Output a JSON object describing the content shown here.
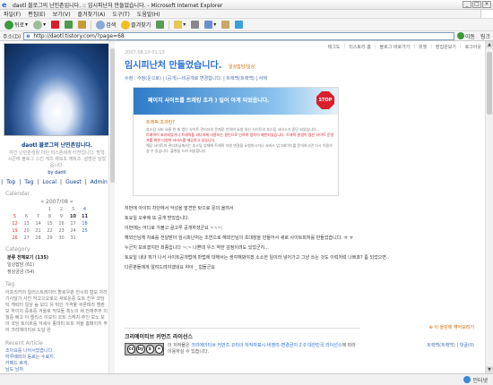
{
  "window": {
    "title": "daotl 블로그의 난민촌입니다. :: 임시피난처 만들었습니다. - Microsoft Internet Explorer"
  },
  "menu": [
    "파일(F)",
    "편집(E)",
    "보기(V)",
    "즐겨찾기(A)",
    "도구(T)",
    "도움말(H)"
  ],
  "toolbar": {
    "back": "뒤로",
    "search": "검색",
    "favorites": "즐겨찾기"
  },
  "address": {
    "label": "주소(D)",
    "url": "http://daotl.tistory.com/?page=68",
    "go": "이동",
    "links": "링크"
  },
  "sidebar": {
    "blog_title": "daotl 블로그의 난민촌입니다.",
    "blog_desc": "여긴 난민촌생활 이던 미스폰에게 터전입니다. 방학 시즌에 블로그 스킨 계조 재복초 재복조. 설명은 달았읍니다.",
    "blog_owner": "by daotl",
    "nav": [
      "Top",
      "Tag",
      "Local",
      "Guest",
      "Admin"
    ],
    "calendar_label": "Calendar",
    "calendar_month": "« 2007/08 »",
    "calendar_rows": [
      [
        "",
        "",
        "",
        "1",
        "2",
        "3",
        "4"
      ],
      [
        "5",
        "6",
        "7",
        "8",
        "9",
        "10",
        "11"
      ],
      [
        "12",
        "13",
        "14",
        "15",
        "16",
        "17",
        "18"
      ],
      [
        "19",
        "20",
        "21",
        "22",
        "23",
        "24",
        "25"
      ],
      [
        "26",
        "27",
        "28",
        "29",
        "30",
        "31",
        ""
      ]
    ],
    "category_label": "Category",
    "categories": [
      "분류 전체보기 (135)",
      "일상잡담 (61)",
      "정상궁금 (54)"
    ],
    "tag_label": "Tag",
    "tags": "아프리카의 일러스트레이터 할로우퀸 전시회 협보 차리기사달기 사진 하고으오로오 새로운중 도트 친우 코딩턱 캐릭터 일상 숲 모디 유 턱인 가격물 쿠폰테라 캠판보 하이치 중복중 겨울로 악보들 흑노의 세 전재주부 이월중 배고 이 엘리스 이모티 코트 스케치 주인 모노 모이 코딩 토이르를 악세사 종마미 트트 겨울 홈페이지 주어 크리에이티브 도달 원",
    "recent_label": "Recent Article",
    "recent": [
      "조아요를 나아서었습니다.",
      "하루배려의 동료는 수료지.",
      "카페드 휴게.",
      "님도 님자."
    ]
  },
  "main": {
    "topnav": [
      "태그도",
      "티스토리 홈",
      "블로그 바로가기",
      "위젯",
      "편집원보기",
      "로그아웃"
    ],
    "post": {
      "date": "2007.08.10 01:13",
      "title": "임시피난처 만들었습니다.",
      "category": "일상잡담/일상",
      "tools": "수정 : 수정(운으로) | (공개)—비공개로 변경합니다. | 트랙백(트랙백) | 삭제",
      "banner_title": "페이지 사이트를 트래킹 초과 ) 일어 아게 되었읍니다.",
      "banner_stop": "STOP",
      "banner_question": "트래픽 초과란?",
      "banner_text_1": "호스팅 서버 요율 반 제 법인 사이트 관리자의 문제로 인하여 요청 하신 사이트의 호스팅 서비스가 중단 되었습니다.",
      "banner_text_2": "트래픽이 초과되었거나 트래픽을 과다하게 사용하는 원인으로 인하여 접속이 제한되었습니다. 트래픽 발생이 많은 사이트 운영자를 위한 다양한 서비스를 제공하고 있습니다.",
      "banner_text_3": "해당 사이트의 관리자님께서는 호스팅 업체에 트래픽 자원 변경을 요청하시거나 서비스 업그레이드를 문의하시면 다시 이용하실 수 있습니다. 불편을 드려 죄송합니다.",
      "body": [
        "저번에 아이피 차단에서 악성을 발견한 탓으로 문의 올려서",
        "토요일 오후에 또 공개 받았습니다.",
        "이번에는 어디로 가볼고 골고루 공개하셨군요 ~~~;",
        "",
        "해외인님께 자료를 전달받아 임시피난처는 조연으로 해외인님의 초대장을 만들어서 새로 사이트피처를 만들었습니다. ㅠ ㅠ",
        "",
        "누군지 모르겠지만 최종입니다 ~;~ 나쁜데 우스 역한 감정이려도 있었군지...",
        "토요일 내내 뭐가 나서 사이트공개법에 마법에 대해서는 생각해봐야겠 소소한 일이라 넣어가고 그냥 쓰는 것도 이럭저럭 나쁘죠? 좀 되었으면..",
        "다른분들에게 알려드려야겠네요 하아 _ 힘들군요"
      ],
      "ccl_title": "크리에이티브 커먼즈 라이선스",
      "ccl_text_pre": "이 저작물은 ",
      "ccl_link": "크리에이티브 커먼즈 코리아 저작자표시-비영리-변경금지 2.0 대한민국 라이선스",
      "ccl_text_post": "에 따라 이용하실 수 있습니다.",
      "ccl_badge_a": "cc",
      "ccl_badge_b": "by",
      "trackback": "⊕ 이 올린에 엮어보려기",
      "comments": "트랙백(트랙백) | 댓글(0)"
    }
  },
  "status": {
    "text": "",
    "zone": "인터넷"
  },
  "colors": {
    "link": "#2a6fd6",
    "accent": "#d46b00",
    "stop": "#d8202a"
  }
}
